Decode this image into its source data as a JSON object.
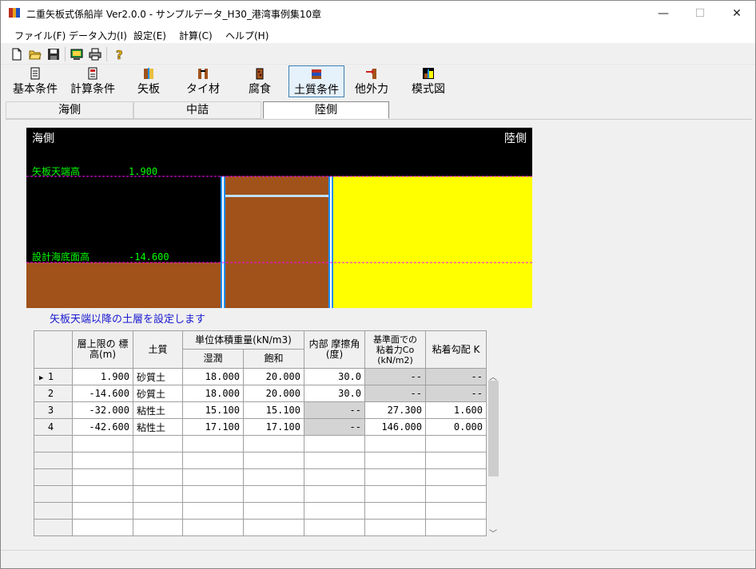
{
  "window": {
    "title": "二重矢板式係船岸 Ver2.0.0 - サンプルデータ_H30_港湾事例集10章",
    "minimize": "—",
    "maximize": "☐",
    "close": "✕"
  },
  "menu": [
    {
      "label": "ファイル(F)"
    },
    {
      "label": "データ入力(I)"
    },
    {
      "label": "設定(E)"
    },
    {
      "label": "計算(C)"
    },
    {
      "label": "ヘルプ(H)"
    }
  ],
  "toolbar2": [
    {
      "label": "基本条件"
    },
    {
      "label": "計算条件"
    },
    {
      "label": "矢板"
    },
    {
      "label": "タイ材"
    },
    {
      "label": "腐食"
    },
    {
      "label": "土質条件"
    },
    {
      "label": "他外力"
    },
    {
      "label": "模式図"
    }
  ],
  "tabs": [
    {
      "label": "海側"
    },
    {
      "label": "中詰"
    },
    {
      "label": "陸側"
    }
  ],
  "diagram": {
    "left_label": "海側",
    "right_label": "陸側",
    "top_label": "矢板天端高",
    "top_value": "1.900",
    "bottom_label": "設計海底面高",
    "bottom_value": "-14.600",
    "colors": {
      "soil": "#a0521a",
      "land": "#ffff00",
      "sheet": "#1e8fff",
      "level_line": "#ff00ff",
      "label": "#00ff00"
    }
  },
  "note": "矢板天端以降の土層を設定します",
  "table": {
    "headers": {
      "top_elev": "層上限の 標高(m)",
      "soil": "土質",
      "unit_weight": "単位体積重量(kN/m3)",
      "wet": "湿潤",
      "saturated": "飽和",
      "friction": "内部 摩擦角(度)",
      "cohesion": "基準面での 粘着力Co (kN/m2)",
      "gradient": "粘着勾配 K"
    },
    "rows": [
      {
        "no": "1",
        "elev": "1.900",
        "soil": "砂質土",
        "wet": "18.000",
        "sat": "20.000",
        "phi": "30.0",
        "co": "--",
        "k": "--"
      },
      {
        "no": "2",
        "elev": "-14.600",
        "soil": "砂質土",
        "wet": "18.000",
        "sat": "20.000",
        "phi": "30.0",
        "co": "--",
        "k": "--"
      },
      {
        "no": "3",
        "elev": "-32.000",
        "soil": "粘性土",
        "wet": "15.100",
        "sat": "15.100",
        "phi": "--",
        "co": "27.300",
        "k": "1.600"
      },
      {
        "no": "4",
        "elev": "-42.600",
        "soil": "粘性土",
        "wet": "17.100",
        "sat": "17.100",
        "phi": "--",
        "co": "146.000",
        "k": "0.000"
      }
    ]
  }
}
